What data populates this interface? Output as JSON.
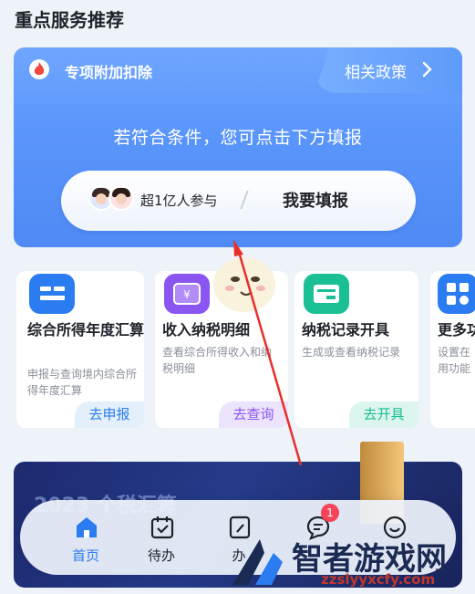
{
  "section_title": "重点服务推荐",
  "feature": {
    "title": "专项附加扣除",
    "policy_label": "相关政策",
    "subtitle": "若符合条件，您可点击下方填报",
    "participants": "超1亿人参与",
    "fill_label": "我要填报"
  },
  "tiles": [
    {
      "title": "综合所得年度汇算",
      "desc": "申报与查询境内综合所得年度汇算",
      "button": "去申报",
      "accent": "#2b7cf0"
    },
    {
      "title": "收入纳税明细",
      "desc": "查看综合所得收入和纳税明细",
      "button": "去查询",
      "accent": "#8a55f1"
    },
    {
      "title": "纳税记录开具",
      "desc": "生成或查看纳税记录",
      "button": "去开具",
      "accent": "#1bbf94"
    },
    {
      "title": "更多功",
      "desc": "设置在用功能",
      "button": "",
      "accent": "#2b7cf0"
    }
  ],
  "banner": {
    "text": "2023 个税汇算"
  },
  "nav": [
    {
      "label": "首页",
      "icon": "home-icon",
      "active": true
    },
    {
      "label": "待办",
      "icon": "calendar-check-icon"
    },
    {
      "label": "办",
      "icon": "edit-doc-icon"
    },
    {
      "label": "",
      "icon": "message-icon",
      "badge": "1"
    },
    {
      "label": "",
      "icon": "smile-icon"
    }
  ],
  "watermark": {
    "text": "智者游戏网",
    "url": "zzslyyxcfy.com"
  },
  "colors": {
    "primary": "#2b7cf0",
    "purple": "#8a55f1",
    "green": "#1bbf94",
    "badge": "#f5445a"
  }
}
